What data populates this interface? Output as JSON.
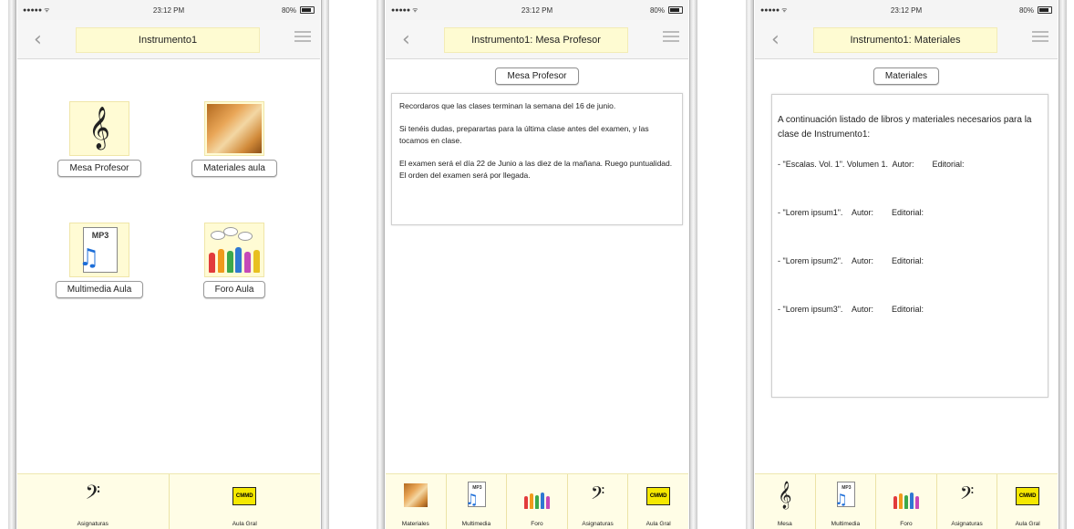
{
  "status": {
    "signal": "●●●●● ᯤ",
    "time": "23:12 PM",
    "battery": "80%"
  },
  "screens": [
    {
      "title": "Instrumento1",
      "tiles": [
        {
          "label": "Mesa Profesor",
          "icon": "treble-clef-icon"
        },
        {
          "label": "Materiales aula",
          "icon": "sheet-music-icon"
        },
        {
          "label": "Multimedia Aula",
          "icon": "mp3-file-icon"
        },
        {
          "label": "Foro Aula",
          "icon": "forum-people-icon"
        }
      ],
      "tabs": [
        {
          "label": "Asignaturas",
          "icon": "bass-clef-icon"
        },
        {
          "label": "Aula Gral",
          "icon": "cmmd-logo-icon"
        }
      ]
    },
    {
      "title": "Instrumento1: Mesa Profesor",
      "section_label": "Mesa Profesor",
      "paragraphs": [
        "Recordaros que las clases terminan la semana del 16 de junio.",
        "Si tenéis dudas, preparartas para la última clase antes del examen, y las tocamos en clase.",
        "El examen será el día 22 de Junio a las diez de la mañana. Ruego puntualidad. El orden del examen será por llegada."
      ],
      "tabs": [
        {
          "label": "Materiales",
          "icon": "sheet-music-icon"
        },
        {
          "label": "Multimedia",
          "icon": "mp3-file-icon"
        },
        {
          "label": "Foro",
          "icon": "forum-people-icon"
        },
        {
          "label": "Asignaturas",
          "icon": "bass-clef-icon"
        },
        {
          "label": "Aula Gral",
          "icon": "cmmd-logo-icon"
        }
      ]
    },
    {
      "title": "Instrumento1: Materiales",
      "section_label": "Materiales",
      "intro": "A continuación listado de libros y materiales necesarios para la clase de Instrumento1:",
      "items": [
        {
          "title": "- \"Escalas. Vol. 1\". Volumen 1.",
          "autor": "Autor:",
          "editorial": "Editorial:"
        },
        {
          "title": "- \"Lorem ipsum1\".",
          "autor": "Autor:",
          "editorial": "Editorial:"
        },
        {
          "title": "- \"Lorem ipsum2\".",
          "autor": "Autor:",
          "editorial": "Editorial:"
        },
        {
          "title": "- \"Lorem ipsum3\".",
          "autor": "Autor:",
          "editorial": "Editorial:"
        }
      ],
      "tabs": [
        {
          "label": "Mesa",
          "icon": "treble-clef-icon"
        },
        {
          "label": "Multimedia",
          "icon": "mp3-file-icon"
        },
        {
          "label": "Foro",
          "icon": "forum-people-icon"
        },
        {
          "label": "Asignaturas",
          "icon": "bass-clef-icon"
        },
        {
          "label": "Aula Gral",
          "icon": "cmmd-logo-icon"
        }
      ]
    }
  ],
  "icons": {
    "mp3_text": "MP3",
    "logo_text": "CMMD"
  },
  "colors": {
    "title_bg": "#fefbd2",
    "tabbar_bg": "#fffde6",
    "logo_yellow": "#f5e800",
    "note_blue": "#1d6ed8"
  }
}
